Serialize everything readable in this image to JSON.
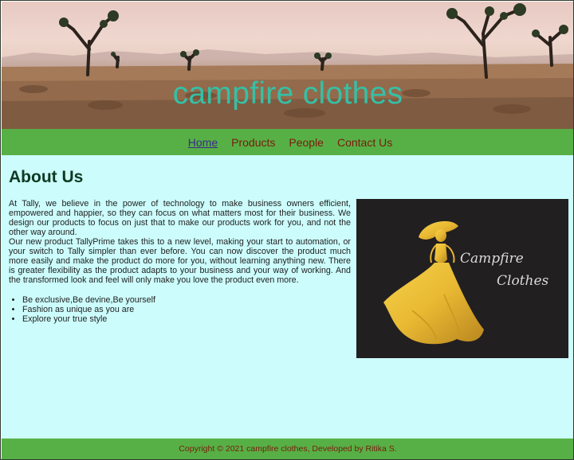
{
  "header": {
    "site_title": "campfire clothes"
  },
  "nav": {
    "items": [
      {
        "label": "Home",
        "active": true
      },
      {
        "label": "Products",
        "active": false
      },
      {
        "label": "People",
        "active": false
      },
      {
        "label": "Contact Us",
        "active": false
      }
    ]
  },
  "main": {
    "title": "About Us",
    "paragraph_1": "At Tally, we believe in the power of technology to make business owners efficient, empowered and happier, so they can focus on what matters most for their business. We design our products to focus on just that to make our products work for you, and not the other way around.",
    "paragraph_2": "Our new product TallyPrime takes this to a new level, making your start to automation, or your switch to Tally simpler than ever before. You can now discover the product much more easily and make the product do more for you, without learning anything new. There is greater flexibility as the product adapts to your business and your way of working. And the transformed look and feel will only make you love the product even more.",
    "bullets": [
      "Be exclusive,Be devine,Be yourself",
      "Fashion as unique as you are",
      "Explore your true style"
    ],
    "logo": {
      "text_line_1": "Campfire",
      "text_line_2": "Clothes",
      "icon": "dress-figure-logo"
    }
  },
  "footer": {
    "text": "Copyright © 2021 campfire clothes, Developed by Ritika S."
  },
  "colors": {
    "title_teal": "#35c0a6",
    "nav_green": "#57b046",
    "nav_link": "#7a1b0c",
    "main_bg": "#ccfcfc",
    "heading": "#0e3a22",
    "logo_bg": "#221f21",
    "logo_gold": "#e8b832"
  }
}
